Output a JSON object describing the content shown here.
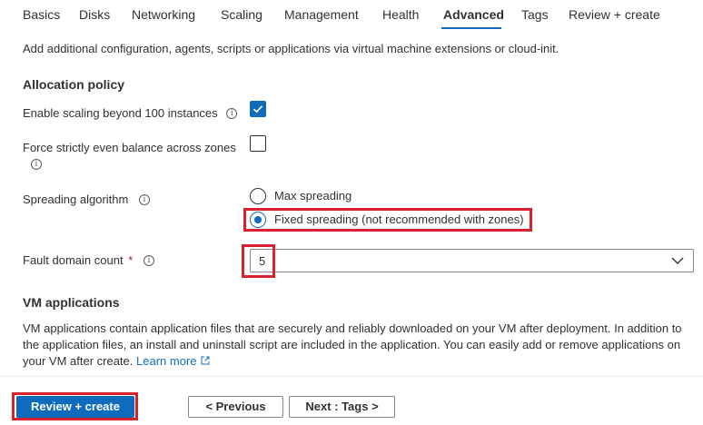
{
  "tabs": [
    {
      "label": "Basics"
    },
    {
      "label": "Disks"
    },
    {
      "label": "Networking"
    },
    {
      "label": "Scaling"
    },
    {
      "label": "Management"
    },
    {
      "label": "Health"
    },
    {
      "label": "Advanced",
      "active": true
    },
    {
      "label": "Tags"
    },
    {
      "label": "Review + create"
    }
  ],
  "intro": "Add additional configuration, agents, scripts or applications via virtual machine extensions or cloud-init.",
  "allocation": {
    "title": "Allocation policy",
    "scaling_beyond_label": "Enable scaling beyond 100 instances",
    "scaling_beyond_checked": true,
    "even_balance_label": "Force strictly even balance across zones",
    "even_balance_checked": false,
    "spreading_label": "Spreading algorithm",
    "spreading_options": [
      {
        "label": "Max spreading",
        "selected": false
      },
      {
        "label": "Fixed spreading (not recommended with zones)",
        "selected": true
      }
    ],
    "fault_domain_label": "Fault domain count",
    "fault_domain_required": "*",
    "fault_domain_value": "5"
  },
  "vm_applications": {
    "title": "VM applications",
    "description": "VM applications contain application files that are securely and reliably downloaded on your VM after deployment. In addition to the application files, an install and uninstall script are included in the application. You can easily add or remove applications on your VM after create.",
    "learn_more": "Learn more"
  },
  "footer": {
    "review_create": "Review + create",
    "previous": "< Previous",
    "next": "Next : Tags >"
  },
  "colors": {
    "accent": "#0f6cbd",
    "highlight": "#d9212f"
  }
}
